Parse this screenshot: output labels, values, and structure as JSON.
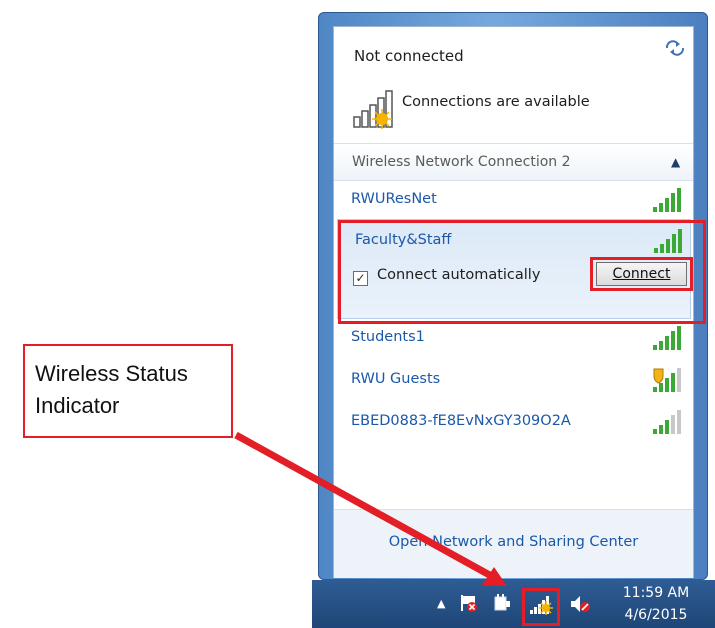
{
  "flyout": {
    "status_title": "Not connected",
    "availability_text": "Connections are available",
    "section_title": "Wireless Network Connection 2",
    "networks": [
      {
        "name": "RWUResNet",
        "signal": 5
      },
      {
        "name": "Faculty&Staff",
        "signal": 5,
        "expanded": true
      },
      {
        "name": "Students1",
        "signal": 5
      },
      {
        "name": "RWU Guests",
        "signal": 4,
        "secured_shield": true
      },
      {
        "name": "EBED0883-fE8EvNxGY309O2A",
        "signal": 3
      }
    ],
    "connect_automatically_label": "Connect automatically",
    "connect_automatically_checked": true,
    "connect_button_label": "Connect",
    "footer_link": "Open Network and Sharing Center"
  },
  "taskbar": {
    "time": "11:59 AM",
    "date": "4/6/2015"
  },
  "annotation": {
    "callout_text": "Wireless Status Indicator"
  },
  "colors": {
    "accent_red": "#e41e26",
    "link_blue": "#1c58a8",
    "signal_green": "#3aa935"
  }
}
